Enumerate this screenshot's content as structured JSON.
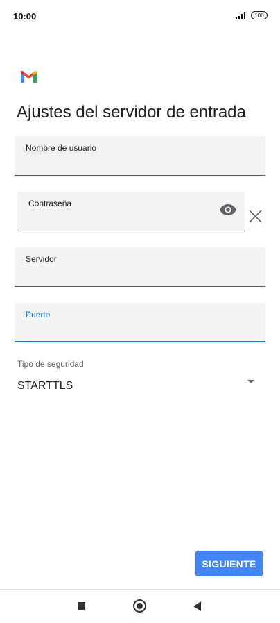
{
  "status_bar": {
    "time": "10:00",
    "battery": "100",
    "icons": [
      "signal-icon",
      "battery-icon"
    ]
  },
  "app": {
    "logo": "gmail-logo",
    "brand_colors": [
      "#ea4335",
      "#4285f4",
      "#34a853",
      "#fbbc04",
      "#c5221f"
    ]
  },
  "page": {
    "title": "Ajustes del servidor de entrada"
  },
  "form": {
    "username": {
      "label": "Nombre de usuario",
      "value": ""
    },
    "password": {
      "label": "Contraseña",
      "value": "",
      "icons": [
        "eye-icon",
        "close-icon"
      ]
    },
    "server": {
      "label": "Servidor",
      "value": ""
    },
    "port": {
      "label": "Puerto",
      "value": "",
      "focused": true
    },
    "security": {
      "label": "Tipo de seguridad",
      "value": "STARTTLS"
    }
  },
  "actions": {
    "next_label": "SIGUIENTE"
  },
  "nav_bar": {
    "icons": [
      "recents-icon",
      "home-icon",
      "back-icon"
    ]
  },
  "colors": {
    "accent": "#1a73e8",
    "button": "#4285f4",
    "field_bg": "#f1f3f4"
  }
}
